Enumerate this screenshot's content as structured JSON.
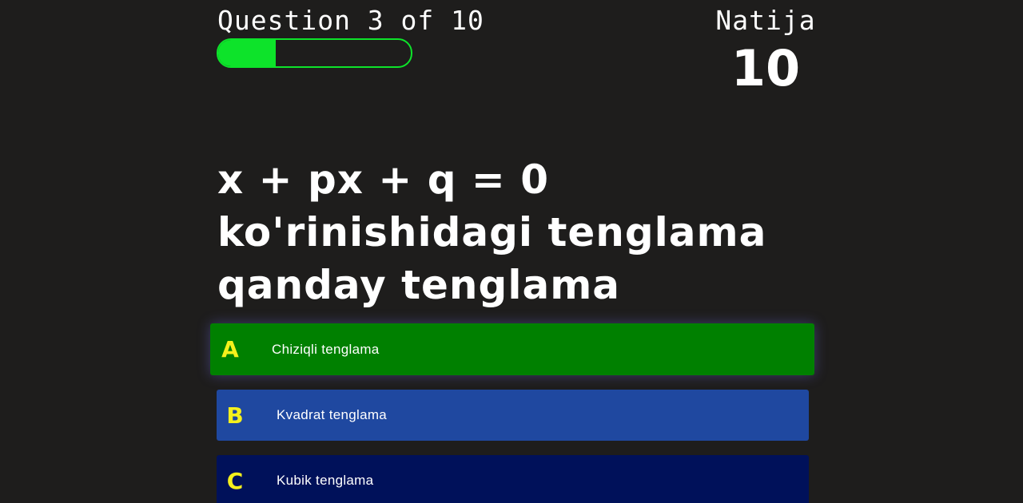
{
  "header": {
    "progress_label": "Question 3 of 10",
    "progress_fraction": 0.3,
    "score_label": "Natija",
    "score_value": "10"
  },
  "question": {
    "text": "x + px + q = 0 ko'rinishidagi tenglama qanday tenglama"
  },
  "answers": [
    {
      "letter": "A",
      "text": "Chiziqli tenglama",
      "color": "#008000"
    },
    {
      "letter": "B",
      "text": "Kvadrat tenglama",
      "color": "#1f48a0"
    },
    {
      "letter": "C",
      "text": "Kubik tenglama",
      "color": "#00115a"
    }
  ],
  "colors": {
    "background": "#1e1d1c",
    "progress_accent": "#0de32a",
    "answer_letter": "#f5f01c"
  }
}
